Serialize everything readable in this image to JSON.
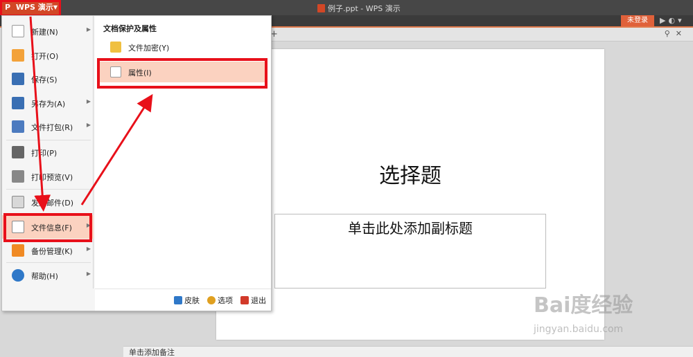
{
  "titlebar": {
    "app_name": "WPS 演示",
    "doc_title": "例子.ppt - WPS 演示",
    "window_buttons": "▶ ◐ 👕"
  },
  "ribbon": {
    "login_label": "未登录"
  },
  "menu": {
    "items": [
      {
        "label": "新建(N)",
        "icon": "new-file-icon",
        "has_submenu": true
      },
      {
        "label": "打开(O)",
        "icon": "open-folder-icon",
        "has_submenu": false
      },
      {
        "label": "保存(S)",
        "icon": "save-icon",
        "has_submenu": false
      },
      {
        "label": "另存为(A)",
        "icon": "save-as-icon",
        "has_submenu": true
      },
      {
        "label": "文件打包(R)",
        "icon": "package-icon",
        "has_submenu": true
      },
      {
        "label": "打印(P)",
        "icon": "print-icon",
        "has_submenu": false
      },
      {
        "label": "打印预览(V)",
        "icon": "print-preview-icon",
        "has_submenu": false
      },
      {
        "label": "发送邮件(D)",
        "icon": "mail-icon",
        "has_submenu": false
      },
      {
        "label": "文件信息(F)",
        "icon": "file-info-icon",
        "has_submenu": true
      },
      {
        "label": "备份管理(K)",
        "icon": "backup-icon",
        "has_submenu": true
      },
      {
        "label": "帮助(H)",
        "icon": "help-icon",
        "has_submenu": true
      }
    ]
  },
  "submenu": {
    "heading": "文档保护及属性",
    "items": [
      {
        "label": "文件加密(Y)",
        "icon": "lock-icon"
      },
      {
        "label": "属性(I)",
        "icon": "properties-icon"
      }
    ]
  },
  "bottom_bar": {
    "skin": "皮肤",
    "options": "选项",
    "exit": "退出"
  },
  "slide": {
    "title": "选择题",
    "subtitle": "单击此处添加副标题"
  },
  "notes": {
    "placeholder": "单击添加备注"
  },
  "watermark": {
    "brand": "Bai度经验",
    "url": "jingyan.baidu.com"
  },
  "colors": {
    "accent": "#d24726",
    "highlight_box": "#e8101a",
    "selected_bg": "#fbd2c0"
  }
}
